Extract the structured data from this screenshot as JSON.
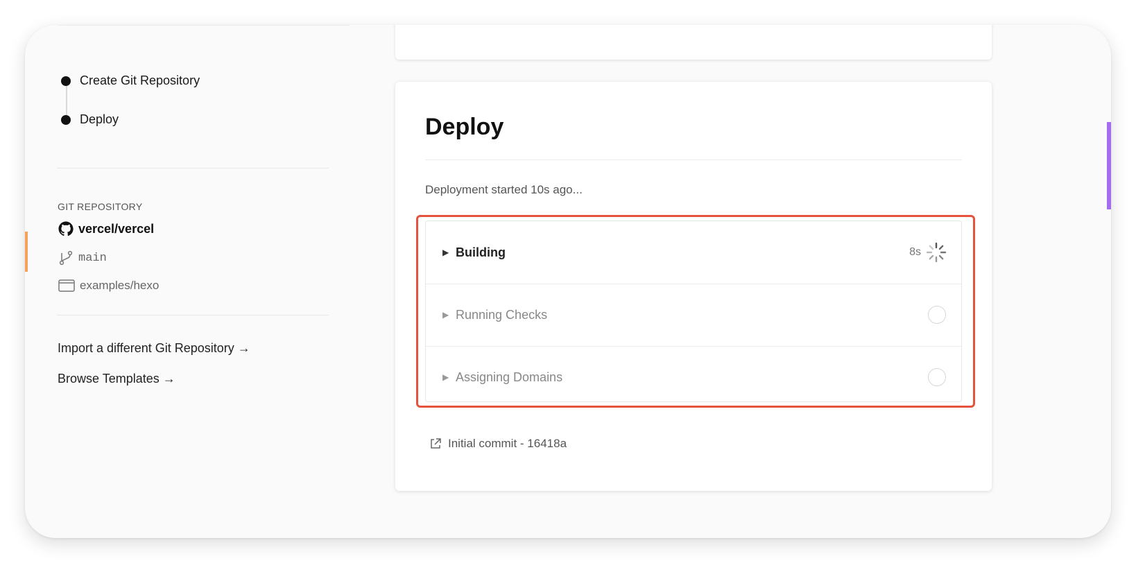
{
  "sidebar": {
    "steps": [
      {
        "label": "Create Git Repository"
      },
      {
        "label": "Deploy"
      }
    ],
    "section_label": "GIT REPOSITORY",
    "repo": {
      "name": "vercel/vercel",
      "branch": "main",
      "path": "examples/hexo"
    },
    "links": [
      {
        "label": "Import a different Git Repository →"
      },
      {
        "label": "Browse Templates →"
      }
    ]
  },
  "deploy": {
    "title": "Deploy",
    "status_text": "Deployment started 10s ago...",
    "steps": [
      {
        "label": "Building",
        "time": "8s",
        "state": "in-progress"
      },
      {
        "label": "Running Checks",
        "state": "pending"
      },
      {
        "label": "Assigning Domains",
        "state": "pending"
      }
    ],
    "commit": "Initial commit - 16418a"
  },
  "colors": {
    "highlight": "#e5533d",
    "accent_orange": "#f4a25c",
    "accent_purple": "#a56cf0"
  },
  "icons": [
    "github-icon",
    "git-branch-icon",
    "folder-icon",
    "external-link-icon",
    "spinner-icon",
    "caret-right-icon"
  ]
}
